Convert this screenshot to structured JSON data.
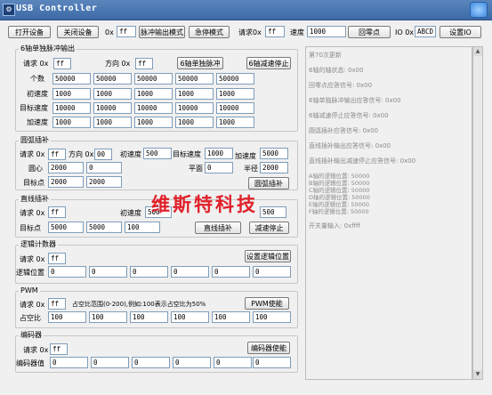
{
  "window": {
    "title": "USB Controller",
    "app_icon": "usb-app-icon",
    "close_icon": "close-icon"
  },
  "toolbar": {
    "open_device": "打开设备",
    "close_device": "关闭设备",
    "ox_label": "0x",
    "ox_value": "ff",
    "pulse_mode": "脉冲输出模式",
    "estop_mode": "急停模式",
    "request_label": "请求0x",
    "request_value": "ff",
    "speed_label": "速度",
    "speed_value": "1000",
    "home": "回零点",
    "io_label": "IO 0x",
    "io_value": "ABCD",
    "set_io": "设置IO"
  },
  "six_axis": {
    "title": "6轴单独脉冲输出",
    "request_label": "请求 0x",
    "request_value": "ff",
    "direction_label": "方向 0x",
    "direction_value": "ff",
    "pulse_button": "6轴单独脉冲",
    "stop_button": "6轴减速停止",
    "rows": [
      {
        "label": "个数",
        "values": [
          "50000",
          "50000",
          "50000",
          "50000",
          "50000"
        ]
      },
      {
        "label": "初速度",
        "values": [
          "1000",
          "1000",
          "1000",
          "1000",
          "1000"
        ]
      },
      {
        "label": "目标速度",
        "values": [
          "10000",
          "10000",
          "10000",
          "10000",
          "10000"
        ]
      },
      {
        "label": "加速度",
        "values": [
          "1000",
          "1000",
          "1000",
          "1000",
          "1000"
        ]
      }
    ]
  },
  "arc": {
    "title": "圆弧插补",
    "request_label": "请求 0x",
    "request_value": "ff",
    "direction_label": "方向 0x",
    "direction_value": "00",
    "init_speed_label": "初速度",
    "init_speed_value": "500",
    "target_speed_label": "目标速度",
    "target_speed_value": "1000",
    "accel_label": "加速度",
    "accel_value": "5000",
    "center_label": "圆心",
    "center_x": "2000",
    "center_y": "0",
    "plane_label": "平面",
    "plane_value": "0",
    "radius_label": "半径",
    "radius_value": "2000",
    "target_label": "目标点",
    "target_x": "2000",
    "target_y": "2000",
    "button": "圆弧插补"
  },
  "linear": {
    "title": "直线插补",
    "request_label": "请求 0x",
    "request_value": "ff",
    "init_speed_label": "初速度",
    "init_speed_value": "500",
    "target_label": "目标点",
    "target_values": [
      "5000",
      "5000",
      "100"
    ],
    "hidden_value": "500",
    "interp_button": "直线插补",
    "stop_button": "减速停止"
  },
  "logic_counter": {
    "title": "逻辑计数器",
    "request_label": "请求 0x",
    "request_value": "ff",
    "set_button": "设置逻辑位置",
    "pos_label": "逻辑位置",
    "values": [
      "0",
      "0",
      "0",
      "0",
      "0",
      "0"
    ]
  },
  "pwm": {
    "title": "PWM",
    "request_label": "请求 0x",
    "request_value": "ff",
    "hint": "占空比范围(0-200),例如:100表示占空比为50%",
    "enable_button": "PWM使能",
    "duty_label": "占空比",
    "values": [
      "100",
      "100",
      "100",
      "100",
      "100",
      "100"
    ]
  },
  "encoder": {
    "title": "编码器",
    "request_label": "请求 0x",
    "request_value": "ff",
    "enable_button": "编码器使能",
    "value_label": "编码器值",
    "values": [
      "0",
      "0",
      "0",
      "0",
      "0",
      "0"
    ]
  },
  "log": {
    "lines": [
      "第70次更新",
      "6轴的轴状态: 0x00",
      "回零点应答信号: 0x00",
      "6轴单独脉冲输出应答信号: 0x00",
      "6轴减速停止应答信号: 0x00",
      "圆弧插补应答信号: 0x00",
      "直线插补输出应答信号: 0x00",
      "直线插补输出减速停止应答信号: 0x00",
      "A轴的逻辑位置: 50000",
      "B轴的逻辑位置: 50000",
      "C轴的逻辑位置: 50000",
      "D轴的逻辑位置: 50000",
      "E轴的逻辑位置: 50000",
      "F轴的逻辑位置: 50000",
      "开关量输入: 0xffff"
    ]
  },
  "watermark": "维斯特科技"
}
